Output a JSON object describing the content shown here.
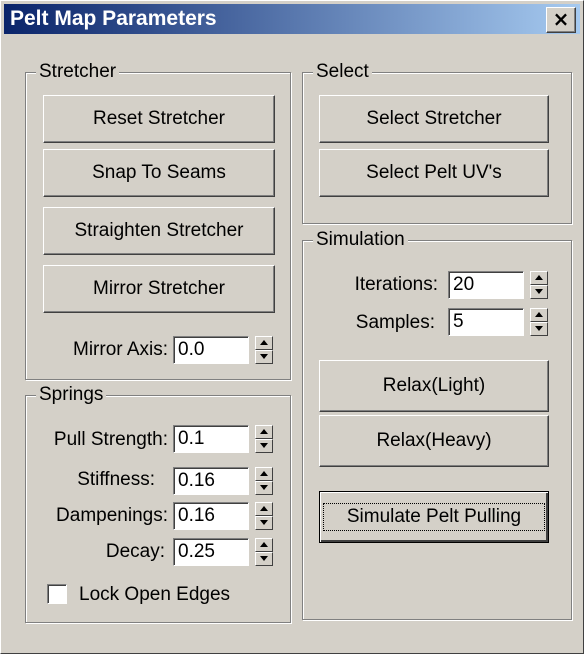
{
  "window": {
    "title": "Pelt Map Parameters",
    "close_glyph": "×"
  },
  "stretcher": {
    "label": "Stretcher",
    "reset": "Reset Stretcher",
    "snap": "Snap To Seams",
    "straighten": "Straighten Stretcher",
    "mirror": "Mirror Stretcher",
    "mirror_axis_label": "Mirror Axis:",
    "mirror_axis_value": "0.0"
  },
  "springs": {
    "label": "Springs",
    "pull_label": "Pull Strength:",
    "pull_value": "0.1",
    "stiffness_label": "Stiffness:",
    "stiffness_value": "0.16",
    "dampenings_label": "Dampenings:",
    "dampenings_value": "0.16",
    "decay_label": "Decay:",
    "decay_value": "0.25",
    "lock_label": "Lock Open Edges",
    "lock_checked": false
  },
  "select": {
    "label": "Select",
    "select_stretcher": "Select Stretcher",
    "select_pelt": "Select Pelt UV's"
  },
  "simulation": {
    "label": "Simulation",
    "iterations_label": "Iterations:",
    "iterations_value": "20",
    "samples_label": "Samples:",
    "samples_value": "5",
    "relax_light": "Relax(Light)",
    "relax_heavy": "Relax(Heavy)",
    "simulate": "Simulate Pelt Pulling"
  }
}
